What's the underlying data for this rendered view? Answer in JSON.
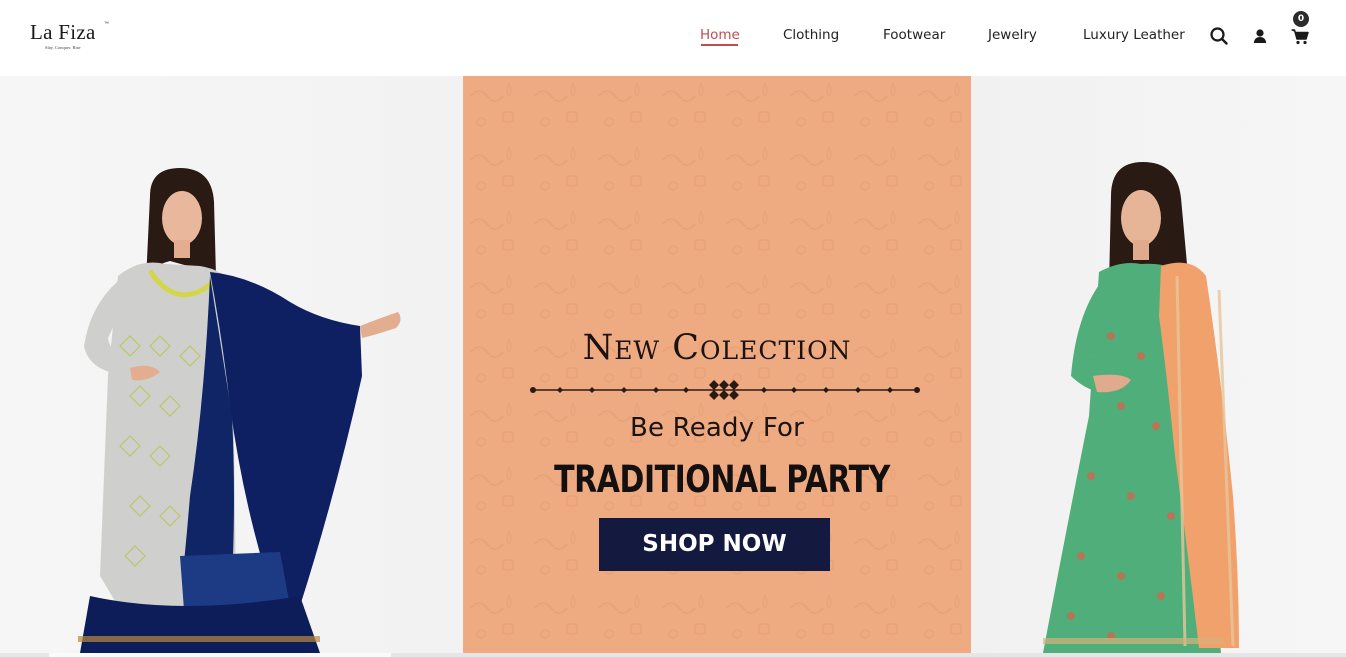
{
  "brand": {
    "name": "La Fiza",
    "tm": "™",
    "tagline": "Slay. Conquer. Rise"
  },
  "nav": {
    "items": [
      {
        "label": "Home",
        "active": true
      },
      {
        "label": "Clothing",
        "active": false
      },
      {
        "label": "Footwear",
        "active": false
      },
      {
        "label": "Jewelry",
        "active": false
      },
      {
        "label": "Luxury Leather",
        "active": false
      }
    ],
    "icons": [
      "search-icon",
      "user-icon",
      "cart-icon"
    ],
    "cart_count": "0"
  },
  "banner": {
    "title": "New Colection",
    "subtitle": "Be Ready For",
    "headline": "TRADITIONAL PARTY",
    "cta": "SHOP NOW"
  },
  "colors": {
    "accent": "#c44a4f",
    "banner_bg": "#eeaa80",
    "button_bg": "#141a3f"
  }
}
